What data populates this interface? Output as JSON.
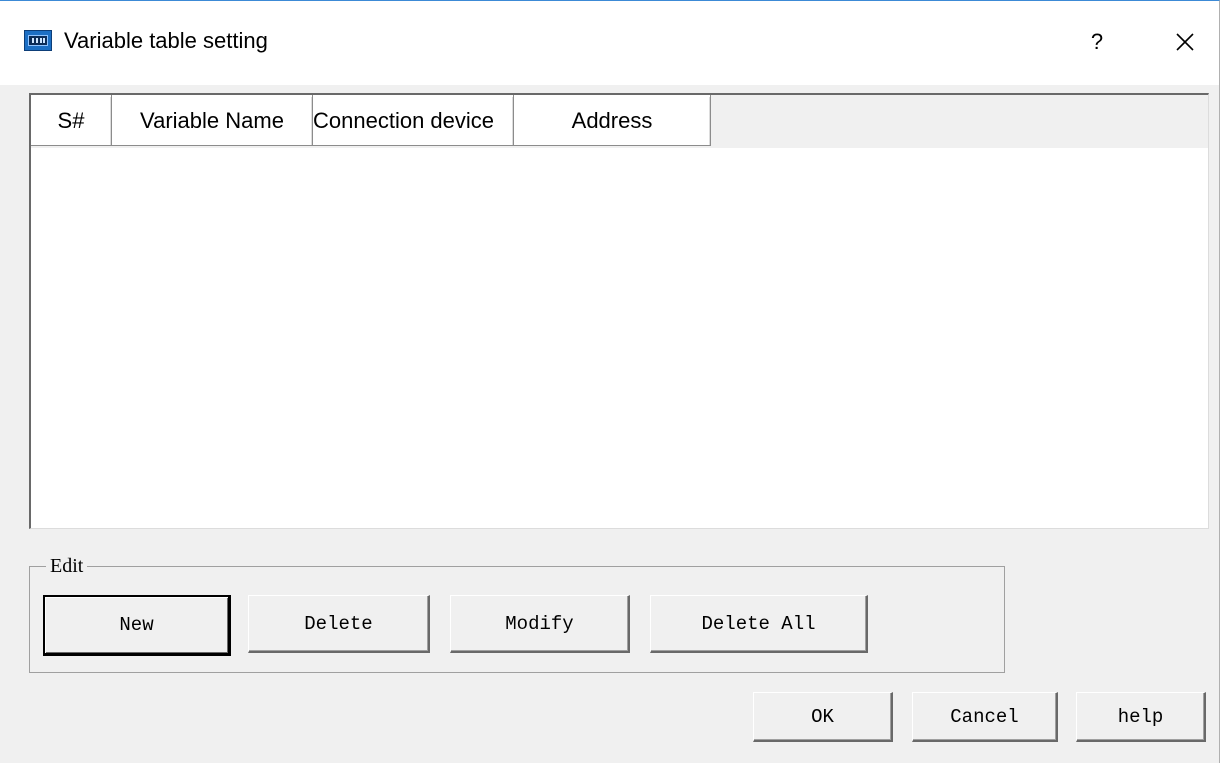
{
  "window": {
    "title": "Variable table setting",
    "help_label": "?",
    "close_label": "×"
  },
  "table": {
    "columns": [
      "S#",
      "Variable Name",
      "Connection device",
      "Address"
    ],
    "rows": []
  },
  "edit_group": {
    "label": "Edit",
    "buttons": [
      "New",
      "Delete",
      "Modify",
      "Delete All"
    ]
  },
  "dialog_buttons": {
    "ok": "OK",
    "cancel": "Cancel",
    "help": "help"
  },
  "colors": {
    "accent_border": "#3c8ad6",
    "app_icon": "#1c6fc4",
    "dialog_bg": "#f0f0f0"
  },
  "icons": {
    "app": "hmi-app-icon",
    "help": "question-icon",
    "close": "close-icon"
  }
}
